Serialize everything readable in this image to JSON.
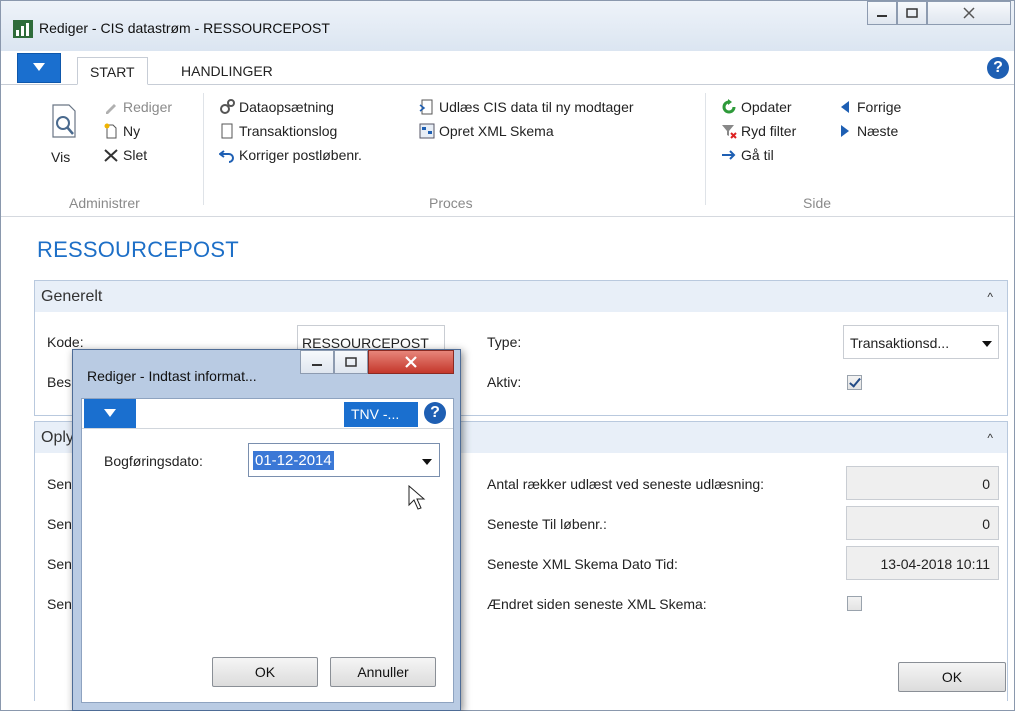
{
  "window": {
    "title": "Rediger - CIS datastrøm - RESSOURCEPOST"
  },
  "tabs": [
    {
      "label": "START"
    },
    {
      "label": "HANDLINGER"
    }
  ],
  "ribbon": {
    "administrer": {
      "label": "Administrer",
      "vis": "Vis",
      "rediger": "Rediger",
      "ny": "Ny",
      "slet": "Slet"
    },
    "proces": {
      "label": "Proces",
      "dataopsaetning": "Dataopsætning",
      "transaktionslog": "Transaktionslog",
      "korriger": "Korriger postløbenr.",
      "udlaes": "Udlæs CIS data til ny modtager",
      "opret_xml": "Opret XML Skema"
    },
    "side": {
      "label": "Side",
      "opdater": "Opdater",
      "ryd_filter": "Ryd filter",
      "gaa_til": "Gå til",
      "forrige": "Forrige",
      "naeste": "Næste"
    }
  },
  "page_title": "RESSOURCEPOST",
  "generelt": {
    "header": "Generelt",
    "kode_label": "Kode:",
    "kode_value": "RESSOURCEPOST",
    "beskrivelse_label": "Bes",
    "type_label": "Type:",
    "type_value": "Transaktionsd...",
    "aktiv_label": "Aktiv:",
    "aktiv_checked": true
  },
  "oplysninger": {
    "header": "Oply",
    "left_labels": [
      "Sen",
      "Sen",
      "Sen",
      "Sen"
    ],
    "antal_label": "Antal rækker udlæst ved seneste udlæsning:",
    "antal_value": "0",
    "til_loebenr_label": "Seneste Til løbenr.:",
    "til_loebenr_value": "0",
    "xml_dato_label": "Seneste XML Skema Dato Tid:",
    "xml_dato_value": "13-04-2018 10:11",
    "aendret_label": "Ændret siden seneste XML Skema:",
    "aendret_checked": false
  },
  "ok_button": "OK",
  "dialog": {
    "title": "Rediger - Indtast informat...",
    "tnv_label": "TNV -...",
    "field_label": "Bogføringsdato:",
    "field_value": "01-12-2014",
    "ok": "OK",
    "cancel": "Annuller"
  },
  "colors": {
    "accent": "#1a6fcf",
    "page_title": "#1d6fc7",
    "dialog_frame": "#b9cbe3",
    "close_button": "#c9473b"
  }
}
